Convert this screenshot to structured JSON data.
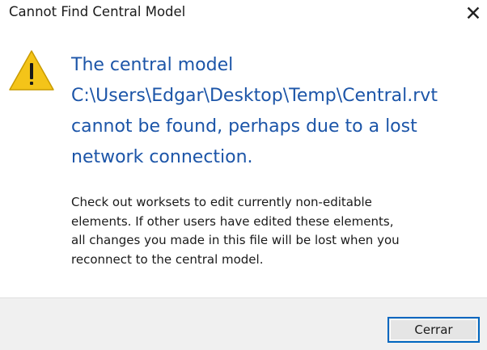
{
  "window": {
    "title": "Cannot Find Central Model",
    "close_glyph": "✕"
  },
  "icon": "warning-icon",
  "main_instruction": [
    "The central model",
    "C:\\Users\\Edgar\\Desktop\\Temp\\Central.rvt",
    "cannot be found, perhaps due to a lost",
    "network connection."
  ],
  "content": [
    "Check out worksets to edit currently non-editable",
    "elements.  If other users have edited these elements,",
    "all changes you made in this file will be lost when you",
    "reconnect to the central model."
  ],
  "footer": {
    "button_label": "Cerrar"
  },
  "colors": {
    "instruction_blue": "#1c55a8",
    "warning_yellow": "#f4c419",
    "footer_bg": "#f0f0f0",
    "button_border": "#0067c0"
  }
}
